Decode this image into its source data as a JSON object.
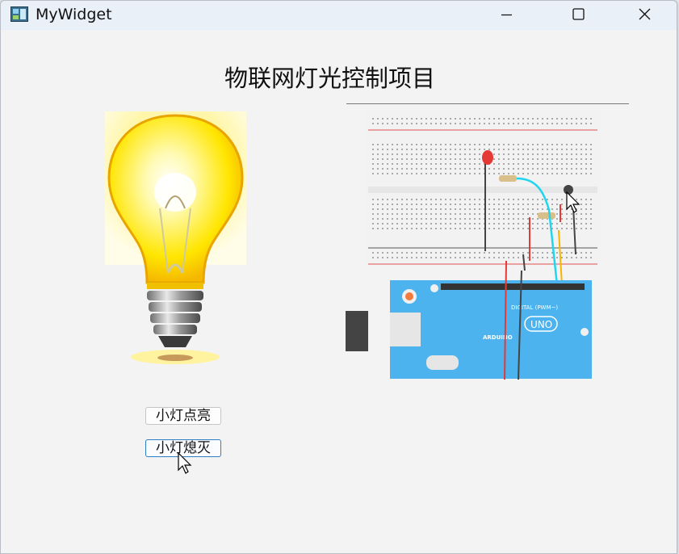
{
  "window": {
    "title": "MyWidget",
    "controls": {
      "minimize": "minimize",
      "maximize": "maximize",
      "close": "close"
    }
  },
  "main": {
    "heading": "物联网灯光控制项目",
    "buttons": {
      "light_on": "小灯点亮",
      "light_off": "小灯熄灭"
    }
  },
  "board": {
    "logo_text": "ARDUINO",
    "model": "UNO",
    "digital_label": "DIGITAL (PWM~)"
  },
  "colors": {
    "board_blue": "#4db3ee",
    "bulb_yellow": "#ffd400",
    "led_red": "#e53935",
    "wire_cyan": "#1fd6ef",
    "wire_red": "#e53935",
    "wire_yellow": "#f7b500",
    "focus_border": "#2d7ec2"
  }
}
